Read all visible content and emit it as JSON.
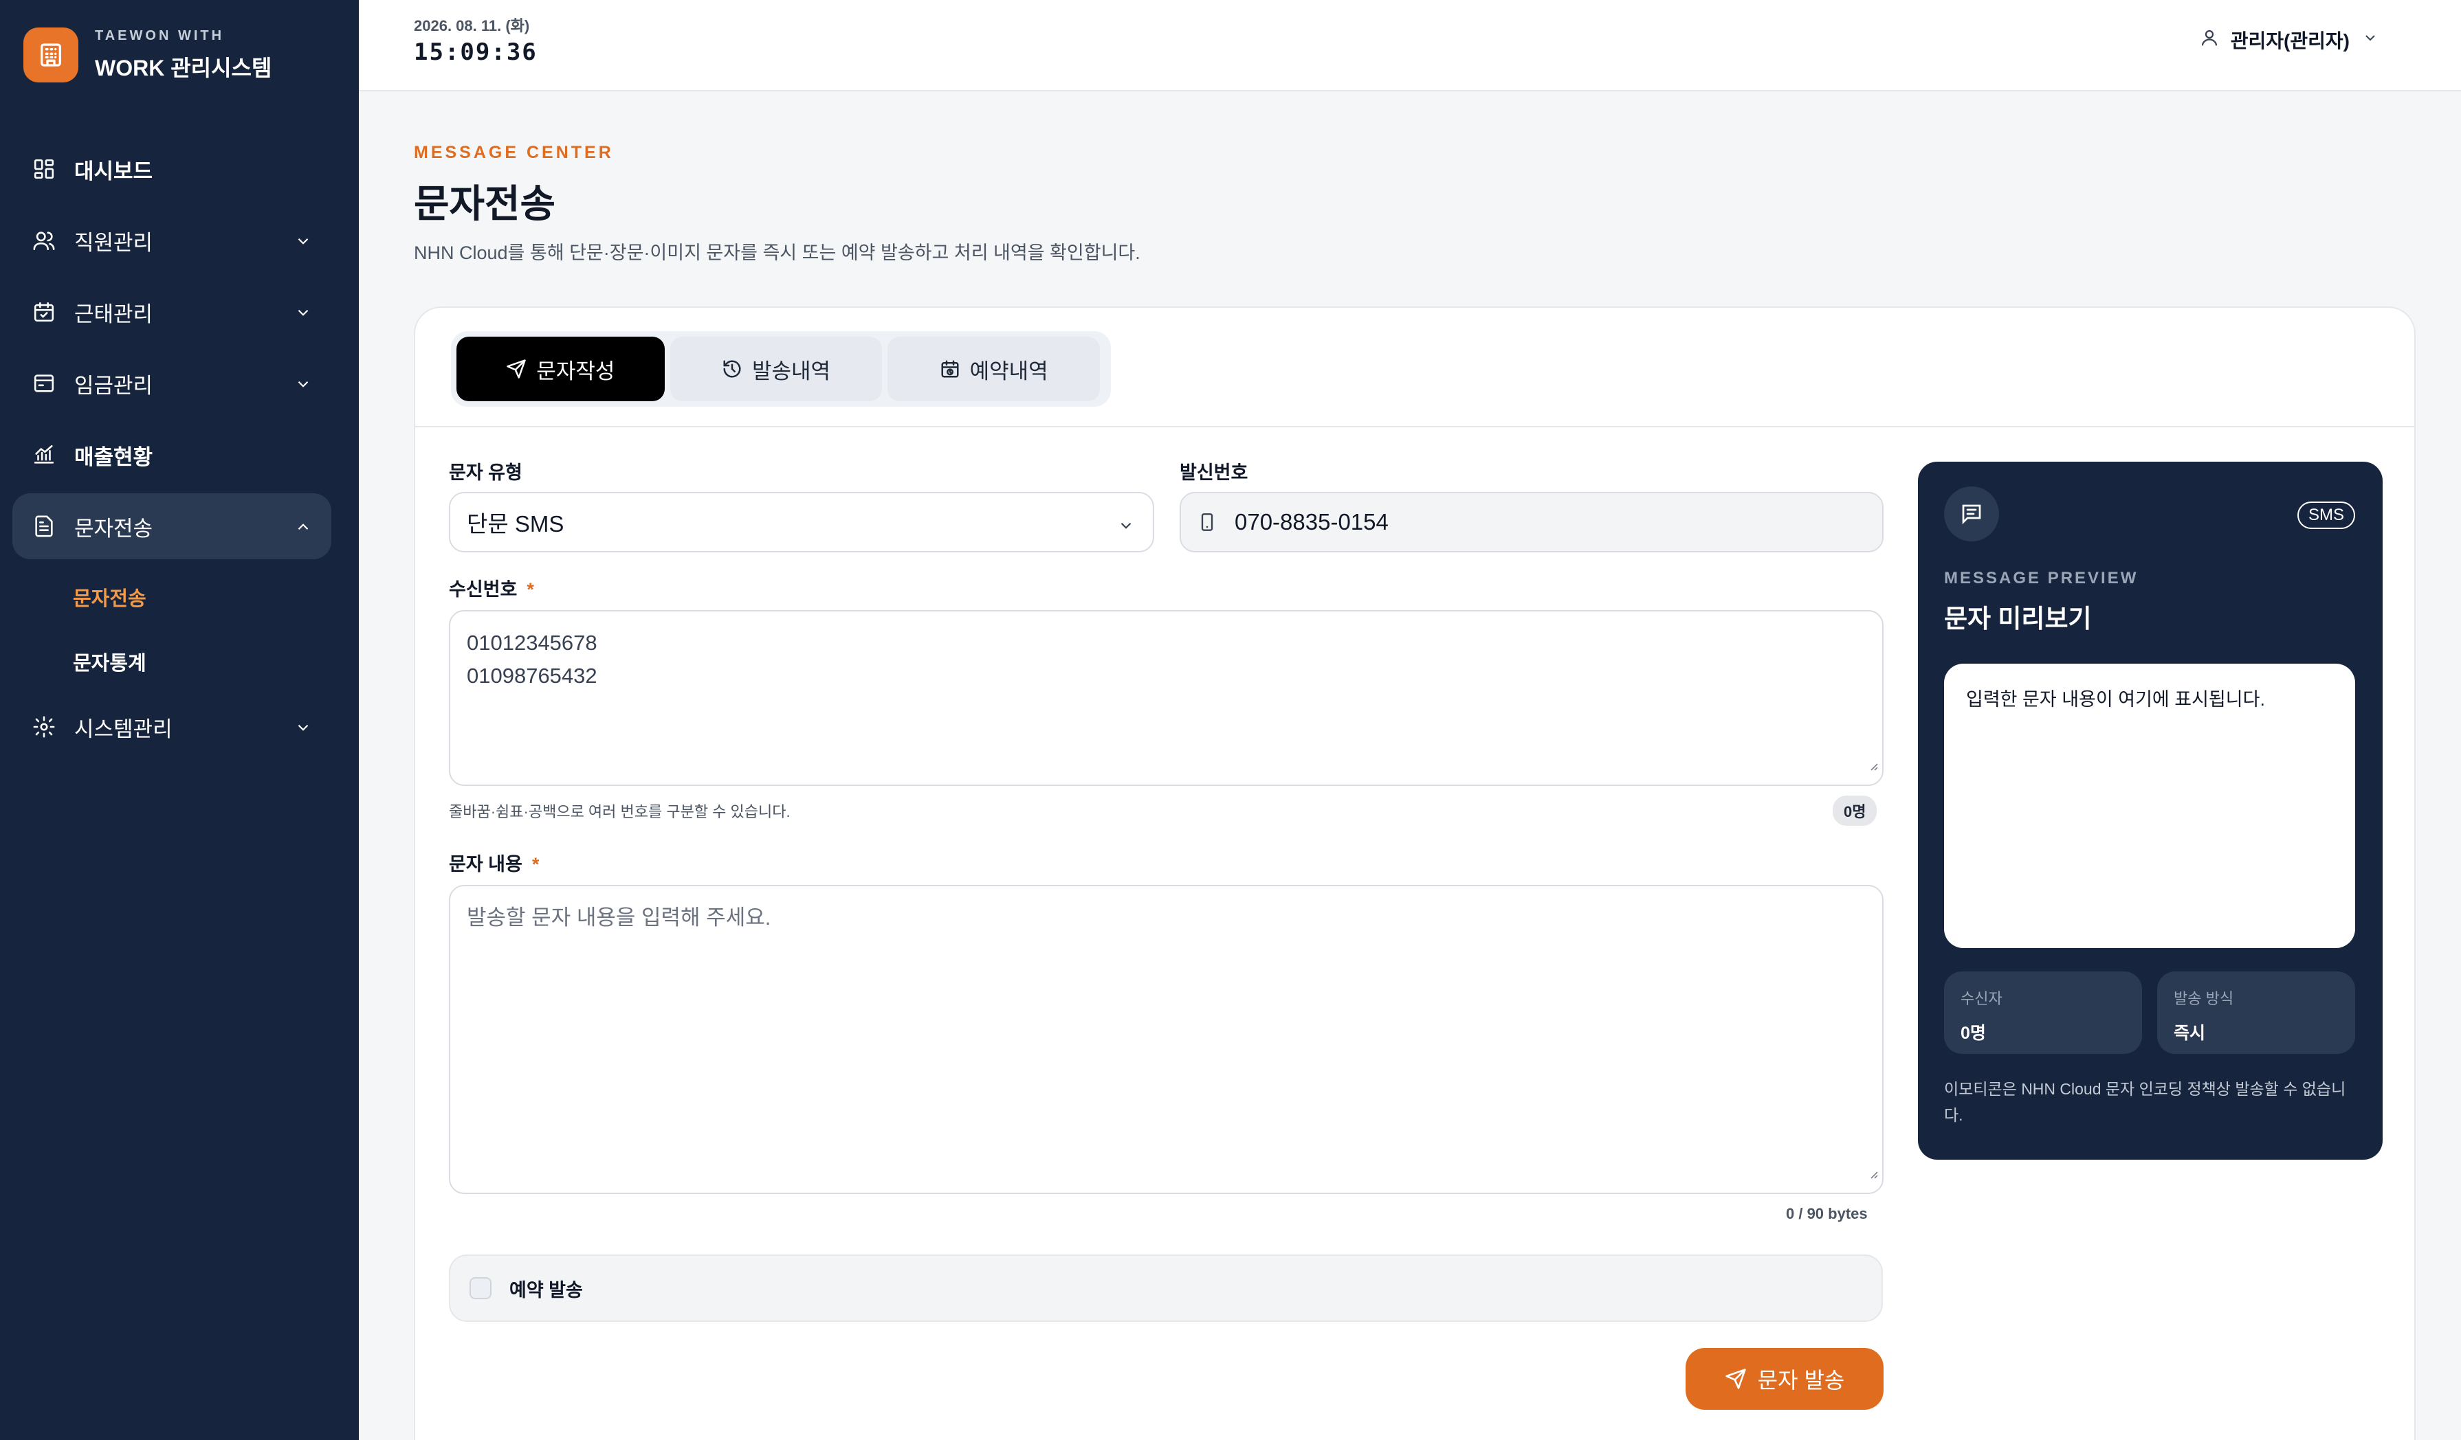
{
  "brand": {
    "sub": "TAEWON WITH",
    "title": "WORK 관리시스템",
    "logo_icon": "building-icon",
    "accent": "#e8742a"
  },
  "sidebar": {
    "items": [
      {
        "label": "대시보드",
        "icon": "dashboard-icon"
      },
      {
        "label": "직원관리",
        "icon": "users-icon"
      },
      {
        "label": "근태관리",
        "icon": "calendar-check-icon"
      },
      {
        "label": "임금관리",
        "icon": "wallet-icon"
      },
      {
        "label": "매출현황",
        "icon": "chart-icon"
      },
      {
        "label": "문자전송",
        "icon": "document-icon"
      },
      {
        "label": "시스템관리",
        "icon": "gear-icon"
      }
    ],
    "sub_items": [
      {
        "label": "문자전송"
      },
      {
        "label": "문자통계"
      }
    ]
  },
  "topbar": {
    "date": "2026. 08. 11. (화)",
    "time": "15:09:36",
    "user": "관리자(관리자)"
  },
  "header": {
    "eyebrow": "MESSAGE CENTER",
    "title": "문자전송",
    "description": "NHN Cloud를 통해 단문·장문·이미지 문자를 즉시 또는 예약 발송하고 처리 내역을 확인합니다."
  },
  "tabs": [
    {
      "label": "문자작성",
      "icon": "send-icon"
    },
    {
      "label": "발송내역",
      "icon": "history-icon"
    },
    {
      "label": "예약내역",
      "icon": "calendar-clock-icon"
    }
  ],
  "form": {
    "type_label": "문자 유형",
    "type_value": "단문 SMS",
    "sender_label": "발신번호",
    "sender_value": "070-8835-0154",
    "recipients_label": "수신번호",
    "required_mark": "*",
    "recipients_lines": [
      "01012345678",
      "01098765432"
    ],
    "recipients_hint": "줄바꿈·쉼표·공백으로 여러 번호를 구분할 수 있습니다.",
    "recipients_count": "0명",
    "content_label": "문자 내용",
    "content_placeholder": "발송할 문자 내용을 입력해 주세요.",
    "bytes": "0 / 90 bytes",
    "schedule_label": "예약 발송",
    "send_label": "문자 발송"
  },
  "preview": {
    "badge": "SMS",
    "eyebrow": "MESSAGE PREVIEW",
    "title": "문자 미리보기",
    "bubble_text": "입력한 문자 내용이 여기에 표시됩니다.",
    "recipients_key": "수신자",
    "recipients_value": "0명",
    "method_key": "발송 방식",
    "method_value": "즉시",
    "note": "이모티콘은 NHN Cloud 문자 인코딩 정책상 발송할 수 없습니다."
  }
}
